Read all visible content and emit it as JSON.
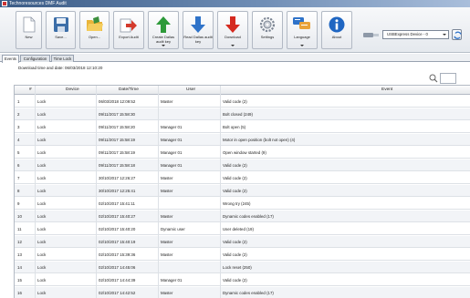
{
  "window": {
    "title": "Technoresources DMF Audit"
  },
  "toolbar": {
    "buttons": [
      {
        "label": "New",
        "icon": "new-icon",
        "has_menu": false
      },
      {
        "label": "Save...",
        "icon": "save-icon",
        "has_menu": false
      },
      {
        "label": "Open...",
        "icon": "open-folder-icon",
        "has_menu": false
      },
      {
        "label": "Export Audit",
        "icon": "export-icon",
        "has_menu": false
      },
      {
        "label": "Create Dallas audit key",
        "icon": "upload-green-arrow-icon",
        "has_menu": true
      },
      {
        "label": "Read Dallas audit key",
        "icon": "download-blue-arrow-icon",
        "has_menu": false
      },
      {
        "label": "Download",
        "icon": "download-red-arrow-icon",
        "has_menu": true
      },
      {
        "label": "Settings",
        "icon": "gear-icon",
        "has_menu": false
      },
      {
        "label": "Language",
        "icon": "language-icon",
        "has_menu": true
      },
      {
        "label": "About",
        "icon": "info-icon",
        "has_menu": false
      }
    ],
    "device_select": {
      "value": "USBExpress Device - 0"
    },
    "colors": {
      "save": "#3c6ea8",
      "export": "#d33a2c",
      "green": "#2e9a3a",
      "blue": "#2f73c9",
      "red": "#d52a1f",
      "info": "#1f66c2"
    }
  },
  "tabs": [
    {
      "label": "Events",
      "active": true
    },
    {
      "label": "Configuration",
      "active": false
    },
    {
      "label": "Time Lock",
      "active": false
    }
  ],
  "download_info": "Download time and date: 06/03/2018 12:10:20",
  "table": {
    "columns": [
      "#",
      "Device",
      "Date/Time",
      "User",
      "Event"
    ],
    "rows": [
      [
        "1",
        "Lock",
        "06/03/2018 12:09:52",
        "Master",
        "Valid code (2)"
      ],
      [
        "2",
        "Lock",
        "09/11/2017 15:58:30",
        "",
        "Bolt closed (249)"
      ],
      [
        "3",
        "Lock",
        "09/11/2017 15:58:20",
        "Manager 01",
        "Bolt open (5)"
      ],
      [
        "4",
        "Lock",
        "09/11/2017 15:58:19",
        "Manager 01",
        "Motor in open position (bolt not open) (4)"
      ],
      [
        "5",
        "Lock",
        "09/11/2017 15:58:19",
        "Manager 01",
        "Open window started (9)"
      ],
      [
        "6",
        "Lock",
        "09/11/2017 15:58:18",
        "Manager 01",
        "Valid code (2)"
      ],
      [
        "7",
        "Lock",
        "30/10/2017 12:26:27",
        "Master",
        "Valid code (2)"
      ],
      [
        "8",
        "Lock",
        "30/10/2017 12:25:41",
        "Master",
        "Valid code (2)"
      ],
      [
        "9",
        "Lock",
        "02/10/2017 15:41:11",
        "",
        "Wrong try (245)"
      ],
      [
        "10",
        "Lock",
        "02/10/2017 15:40:27",
        "Master",
        "Dynamic codes enabled (17)"
      ],
      [
        "11",
        "Lock",
        "02/10/2017 15:40:20",
        "Dynamic user",
        "User deleted (19)"
      ],
      [
        "12",
        "Lock",
        "02/10/2017 15:40:19",
        "Master",
        "Valid code (2)"
      ],
      [
        "13",
        "Lock",
        "02/10/2017 15:39:36",
        "Master",
        "Valid code (2)"
      ],
      [
        "14",
        "Lock",
        "02/10/2017 14:45:06",
        "",
        "Lock reset (250)"
      ],
      [
        "15",
        "Lock",
        "02/10/2017 14:44:39",
        "Manager 01",
        "Valid code (2)"
      ],
      [
        "16",
        "Lock",
        "02/10/2017 14:42:52",
        "Master",
        "Dynamic codes enabled (17)"
      ]
    ]
  }
}
